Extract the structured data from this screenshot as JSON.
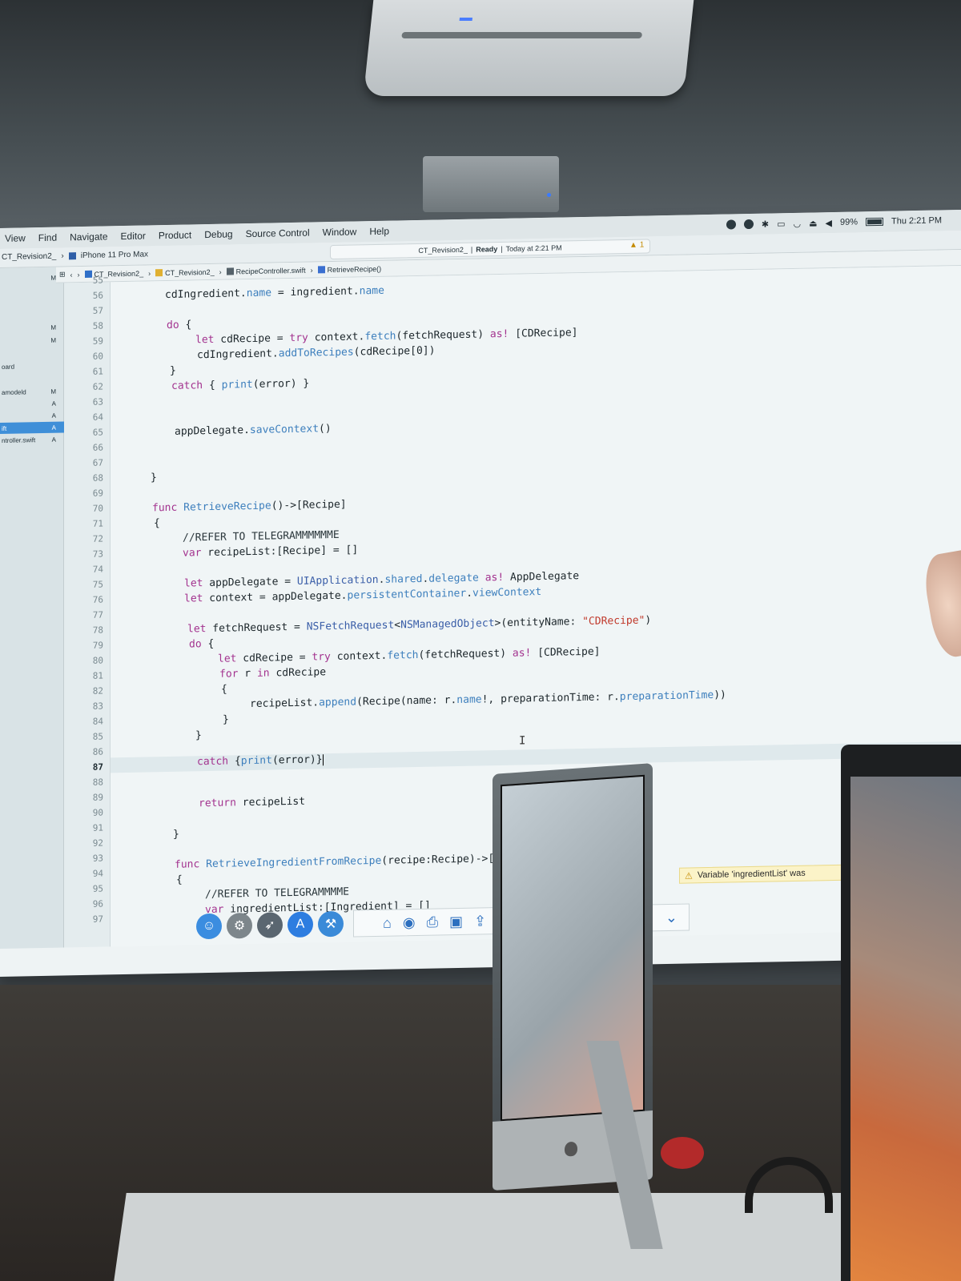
{
  "menubar": {
    "items": [
      "View",
      "Find",
      "Navigate",
      "Editor",
      "Product",
      "Debug",
      "Source Control",
      "Window",
      "Help"
    ],
    "battery": "99%",
    "clock": "Thu 2:21 PM"
  },
  "toolbar": {
    "scheme": "CT_Revision2_",
    "device": "iPhone 11 Pro Max",
    "status_project": "CT_Revision2_",
    "status_state": "Ready",
    "status_time": "Today at 2:21 PM",
    "warning_count": "1"
  },
  "jumpbar": {
    "crumbs": [
      "CT_Revision2_",
      "CT_Revision2_",
      "RecipeController.swift",
      "RetrieveRecipe()"
    ]
  },
  "navigator": {
    "rows": [
      {
        "label": "",
        "badge": "M"
      },
      {
        "label": "",
        "badge": "M"
      },
      {
        "label": "",
        "badge": "M"
      },
      {
        "label": "oard",
        "badge": ""
      },
      {
        "label": "amodeld",
        "badge": "M"
      },
      {
        "label": "",
        "badge": "A"
      },
      {
        "label": "",
        "badge": "A"
      },
      {
        "label": "ift",
        "badge": "A"
      },
      {
        "label": "ntroller.swift",
        "badge": "A"
      }
    ]
  },
  "gutter": {
    "lines": [
      "55",
      "56",
      "57",
      "58",
      "59",
      "60",
      "61",
      "62",
      "63",
      "64",
      "65",
      "66",
      "67",
      "68",
      "69",
      "70",
      "71",
      "72",
      "73",
      "74",
      "75",
      "76",
      "77",
      "78",
      "79",
      "80",
      "81",
      "82",
      "83",
      "84",
      "85",
      "86",
      "87",
      "88",
      "89",
      "90",
      "91",
      "92",
      "93",
      "94",
      "95",
      "96",
      "97"
    ],
    "current_line": "87"
  },
  "code": {
    "l56": {
      "a": "cdIngredient.",
      "b": "name",
      "c": " = ingredient.",
      "d": "name"
    },
    "l58": {
      "kw": "do",
      "rest": " {"
    },
    "l59": {
      "kw1": "let",
      "a": " cdRecipe = ",
      "kw2": "try",
      "b": " context.",
      "fn": "fetch",
      "c": "(fetchRequest) ",
      "kw3": "as!",
      "d": " [CDRecipe]"
    },
    "l60": {
      "a": "cdIngredient.",
      "fn": "addToRecipes",
      "b": "(cdRecipe[0])"
    },
    "l61": "}",
    "l62": {
      "kw": "catch",
      "a": " { ",
      "fn": "print",
      "b": "(error) }"
    },
    "l65": {
      "a": "appDelegate.",
      "fn": "saveContext",
      "b": "()"
    },
    "l68": "}",
    "l70": {
      "kw": "func",
      "fn": " RetrieveRecipe",
      "b": "()->[Recipe]"
    },
    "l71": "{",
    "l72": "//REFER TO TELEGRAMMMMMME",
    "l73": {
      "kw": "var",
      "a": " recipeList:[Recipe] = []"
    },
    "l75": {
      "kw": "let",
      "a": " appDelegate = ",
      "ty": "UIApplication",
      "b": ".",
      "p1": "shared",
      "c": ".",
      "p2": "delegate",
      "d": " ",
      "kw2": "as!",
      "e": " AppDelegate"
    },
    "l76": {
      "kw": "let",
      "a": " context = appDelegate.",
      "p": "persistentContainer",
      "b": ".",
      "p2": "viewContext"
    },
    "l78": {
      "kw": "let",
      "a": " fetchRequest = ",
      "ty": "NSFetchRequest",
      "b": "<",
      "ty2": "NSManagedObject",
      "c": ">(entityName: ",
      "str": "\"CDRecipe\"",
      "d": ")"
    },
    "l79": {
      "kw": "do",
      "rest": " {"
    },
    "l80": {
      "kw1": "let",
      "a": " cdRecipe = ",
      "kw2": "try",
      "b": " context.",
      "fn": "fetch",
      "c": "(fetchRequest) ",
      "kw3": "as!",
      "d": " [CDRecipe]"
    },
    "l81": {
      "kw": "for",
      "a": " r ",
      "kw2": "in",
      "b": " cdRecipe"
    },
    "l82": "{",
    "l83": {
      "a": "recipeList.",
      "fn": "append",
      "b": "(Recipe(name: r.",
      "p1": "name",
      "c": "!, preparationTime: r.",
      "p2": "preparationTime",
      "d": "))"
    },
    "l84": "}",
    "l85": "}",
    "l87": {
      "kw": "catch",
      "a": " {",
      "fn": "print",
      "b": "(error)}"
    },
    "l89": {
      "kw": "return",
      "a": " recipeList"
    },
    "l91": "}",
    "l93": {
      "kw": "func",
      "fn": " RetrieveIngredientFromRecipe",
      "b": "(recipe:Recipe)->["
    },
    "l94": "{",
    "l95": "//REFER TO TELEGRAMMMME",
    "l96": {
      "kw": "var",
      "a": " ingredientList:[Ingredient] = []"
    }
  },
  "issue": {
    "text": "Variable 'ingredientList' was"
  },
  "colors": {
    "selection": "#3f8fd8",
    "keyword": "#a3338f",
    "type": "#3a5ea8",
    "function": "#3d7fbd",
    "string": "#c0392b",
    "warning": "#fbf3c8"
  }
}
